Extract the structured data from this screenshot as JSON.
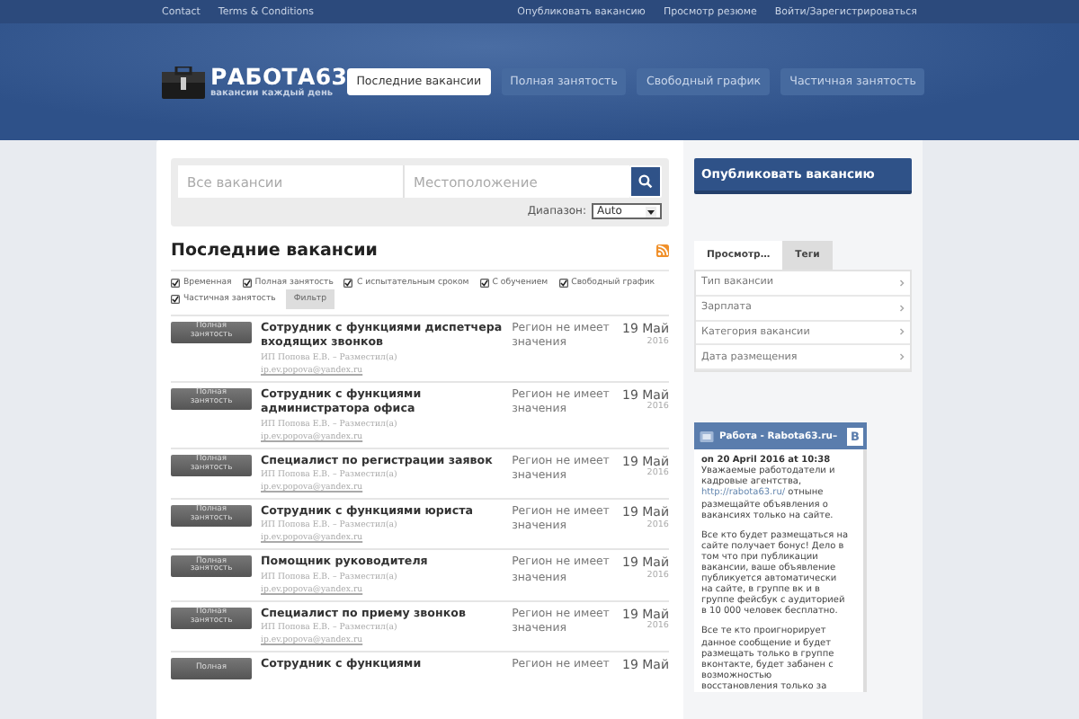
{
  "top_bar": {
    "left_links": [
      "Contact",
      "Terms & Conditions"
    ],
    "right_links": [
      "Опубликовать вакансию",
      "Просмотр резюме",
      "Войти/Зарегистрироваться"
    ]
  },
  "logo": {
    "title": "РАБОТА63",
    "tagline": "вакансии каждый день"
  },
  "nav": [
    {
      "label": "Последние вакансии",
      "selected": true
    },
    {
      "label": "Полная занятость",
      "selected": false
    },
    {
      "label": "Свободный график",
      "selected": false
    },
    {
      "label": "Частичная занятость",
      "selected": false
    }
  ],
  "search": {
    "keywords_placeholder": "Все вакансии",
    "location_placeholder": "Местоположение",
    "range_label": "Диапазон:",
    "range_value": "Auto"
  },
  "section_title": "Последние вакансии",
  "filters": [
    {
      "label": "Временная",
      "checked": true
    },
    {
      "label": "Полная занятость",
      "checked": true
    },
    {
      "label": "С испытательным сроком",
      "checked": true
    },
    {
      "label": "С обучением",
      "checked": true
    },
    {
      "label": "Свободный график",
      "checked": true
    },
    {
      "label": "Частичная занятость",
      "checked": true
    }
  ],
  "filter_button": "Фильтр",
  "jobs": [
    {
      "type": "Полная занятость",
      "title": "Сотрудник с функциями диспетчера входящих звонков",
      "company": "ИП Попова Е.В. – Разместил(а)",
      "email": "ip.ev.popova@yandex.ru",
      "location": "Регион не имеет значения",
      "date": "19 Май",
      "year": "2016"
    },
    {
      "type": "Полная занятость",
      "title": "Сотрудник с функциями администратора офиса",
      "company": "ИП Попова Е.В. – Разместил(а)",
      "email": "ip.ev.popova@yandex.ru",
      "location": "Регион не имеет значения",
      "date": "19 Май",
      "year": "2016"
    },
    {
      "type": "Полная занятость",
      "title": "Специалист по регистрации заявок",
      "company": "ИП Попова Е.В. – Разместил(а)",
      "email": "ip.ev.popova@yandex.ru",
      "location": "Регион не имеет значения",
      "date": "19 Май",
      "year": "2016"
    },
    {
      "type": "Полная занятость",
      "title": "Сотрудник с функциями юриста",
      "company": "ИП Попова Е.В. – Разместил(а)",
      "email": "ip.ev.popova@yandex.ru",
      "location": "Регион не имеет значения",
      "date": "19 Май",
      "year": "2016"
    },
    {
      "type": "Полная занятость",
      "title": "Помощник руководителя",
      "company": "ИП Попова Е.В. – Разместил(а)",
      "email": "ip.ev.popova@yandex.ru",
      "location": "Регион не имеет значения",
      "date": "19 Май",
      "year": "2016"
    },
    {
      "type": "Полная занятость",
      "title": "Специалист по приему звонков",
      "company": "ИП Попова Е.В. – Разместил(а)",
      "email": "ip.ev.popova@yandex.ru",
      "location": "Регион не имеет значения",
      "date": "19 Май",
      "year": "2016"
    },
    {
      "type": "Полная",
      "title": "Сотрудник с функциями",
      "location": "Регион не имеет",
      "date": "19 Май"
    }
  ],
  "sidebar": {
    "post_button": "Опубликовать вакансию",
    "tabs": [
      {
        "label": "Просмотр…",
        "selected": true
      },
      {
        "label": "Теги",
        "selected": false
      }
    ],
    "browse_items": [
      "Тип вакансии",
      "Зарплата",
      "Категория вакансии",
      "Дата размещения"
    ],
    "widget": {
      "title": "Работа - Rabota63.ru–",
      "logo": "В",
      "date": "on 20 April 2016 at 10:38",
      "intro": {
        "before": "Уважаемые работодатели и кадровые агентства,",
        "link": "http://rabota63.ru/",
        "after": "отныне размещайте объявления о вакансиях только на сайте."
      },
      "paragraphs": [
        "Все кто будет размещаться на сайте получает бонус! Дело в том что при публикации вакансии, ваше объявление публикуется автоматически на сайте, в группе вк и в группе фейсбук с аудиторией в 10 000 человек бесплатно.",
        "Все те кто проигнорирует данное сообщение и будет размещать только в группе вконтакте, будет забанен с возможностью восстановления только за"
      ]
    }
  }
}
